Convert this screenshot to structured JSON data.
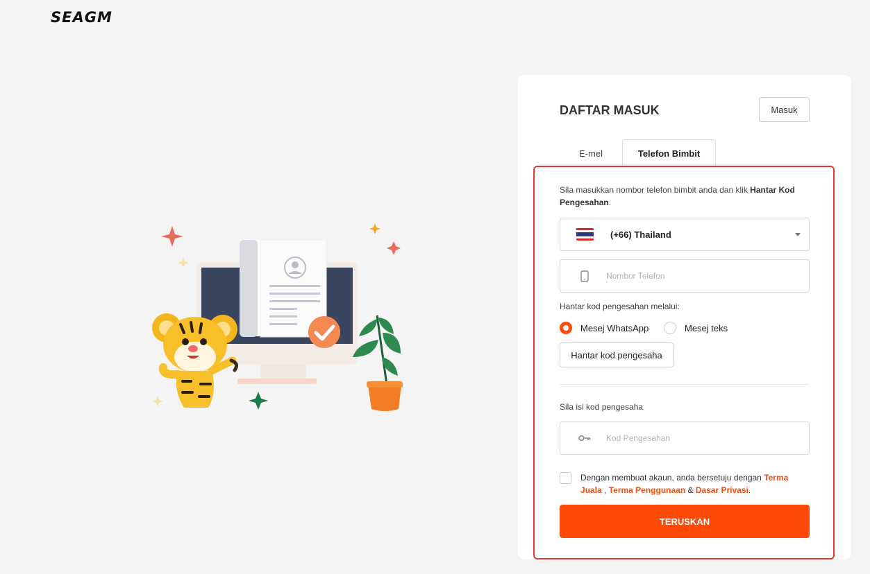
{
  "brand": {
    "logo_text": "SEAGM"
  },
  "card": {
    "title": "DAFTAR MASUK",
    "login_button": "Masuk",
    "tabs": [
      {
        "label": "E-mel",
        "active": false
      },
      {
        "label": "Telefon Bimbit",
        "active": true
      }
    ]
  },
  "form": {
    "intro_prefix": "Sila masukkan nombor telefon bimbit anda dan klik ",
    "intro_bold": "Hantar Kod Pengesahan",
    "intro_suffix": ".",
    "country": {
      "label": "(+66) Thailand",
      "flag_icon": "thailand-flag-icon"
    },
    "phone_placeholder": "Nombor Telefon",
    "send_via_label": "Hantar kod pengesahan melalui:",
    "radio_options": [
      {
        "label": "Mesej WhatsApp",
        "checked": true
      },
      {
        "label": "Mesej teks",
        "checked": false
      }
    ],
    "send_code_button": "Hantar kod pengesaha",
    "fill_code_label": "Sila isi kod pengesaha",
    "code_placeholder": "Kod Pengesahan",
    "agree_prefix": "Dengan membuat akaun, anda bersetuju dengan ",
    "terms_sale": "Terma Juala",
    "sep1": " , ",
    "terms_use": "Terma Penggunaan",
    "sep2": " & ",
    "privacy": "Dasar Privasi",
    "agree_suffix": ".",
    "submit_button": "TERUSKAN"
  },
  "colors": {
    "accent": "#ff4a0a",
    "highlight": "#e53935"
  }
}
